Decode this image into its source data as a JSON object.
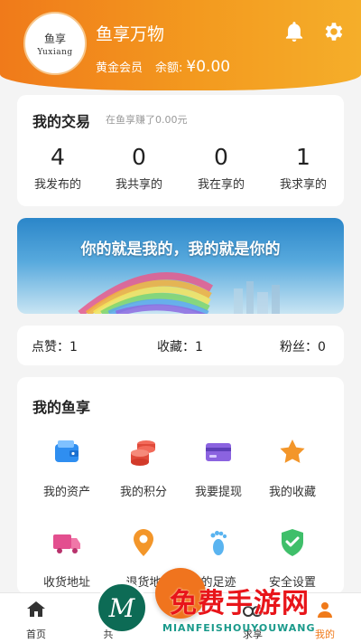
{
  "header": {
    "avatar_cn": "鱼享",
    "avatar_en": "Yuxiang",
    "app_name": "鱼享万物",
    "member_level": "黄金会员",
    "balance_label": "余额:",
    "balance_value": "¥0.00"
  },
  "trade": {
    "title": "我的交易",
    "subtitle": "在鱼享赚了0.00元",
    "stats": [
      {
        "num": "4",
        "label": "我发布的"
      },
      {
        "num": "0",
        "label": "我共享的"
      },
      {
        "num": "0",
        "label": "我在享的"
      },
      {
        "num": "1",
        "label": "我求享的"
      }
    ]
  },
  "banner": {
    "slogan": "你的就是我的，我的就是你的"
  },
  "social": {
    "likes": "点赞：1",
    "favorites": "收藏：1",
    "fans": "粉丝：0"
  },
  "my_fish": {
    "title": "我的鱼享",
    "items": [
      {
        "label": "我的资产",
        "icon": "wallet-icon"
      },
      {
        "label": "我的积分",
        "icon": "coins-icon"
      },
      {
        "label": "我要提现",
        "icon": "card-icon"
      },
      {
        "label": "我的收藏",
        "icon": "star-icon"
      },
      {
        "label": "收货地址",
        "icon": "truck-icon"
      },
      {
        "label": "退货地",
        "icon": "location-icon"
      },
      {
        "label": "的足迹",
        "icon": "footprint-icon"
      },
      {
        "label": "安全设置",
        "icon": "shield-icon"
      }
    ]
  },
  "tabbar": {
    "tabs": [
      {
        "label": "首页",
        "icon": "home-icon"
      },
      {
        "label": "共",
        "icon": "share-icon"
      },
      {
        "label": "求享",
        "icon": "request-icon"
      },
      {
        "label": "我的",
        "icon": "profile-icon"
      }
    ]
  },
  "watermark": {
    "logo_letter": "M",
    "text": "免费手游网",
    "sub": "MIANFEISHOUYOUWANG"
  },
  "colors": {
    "accent": "#f39a1f",
    "watermark_red": "#e8151a"
  }
}
